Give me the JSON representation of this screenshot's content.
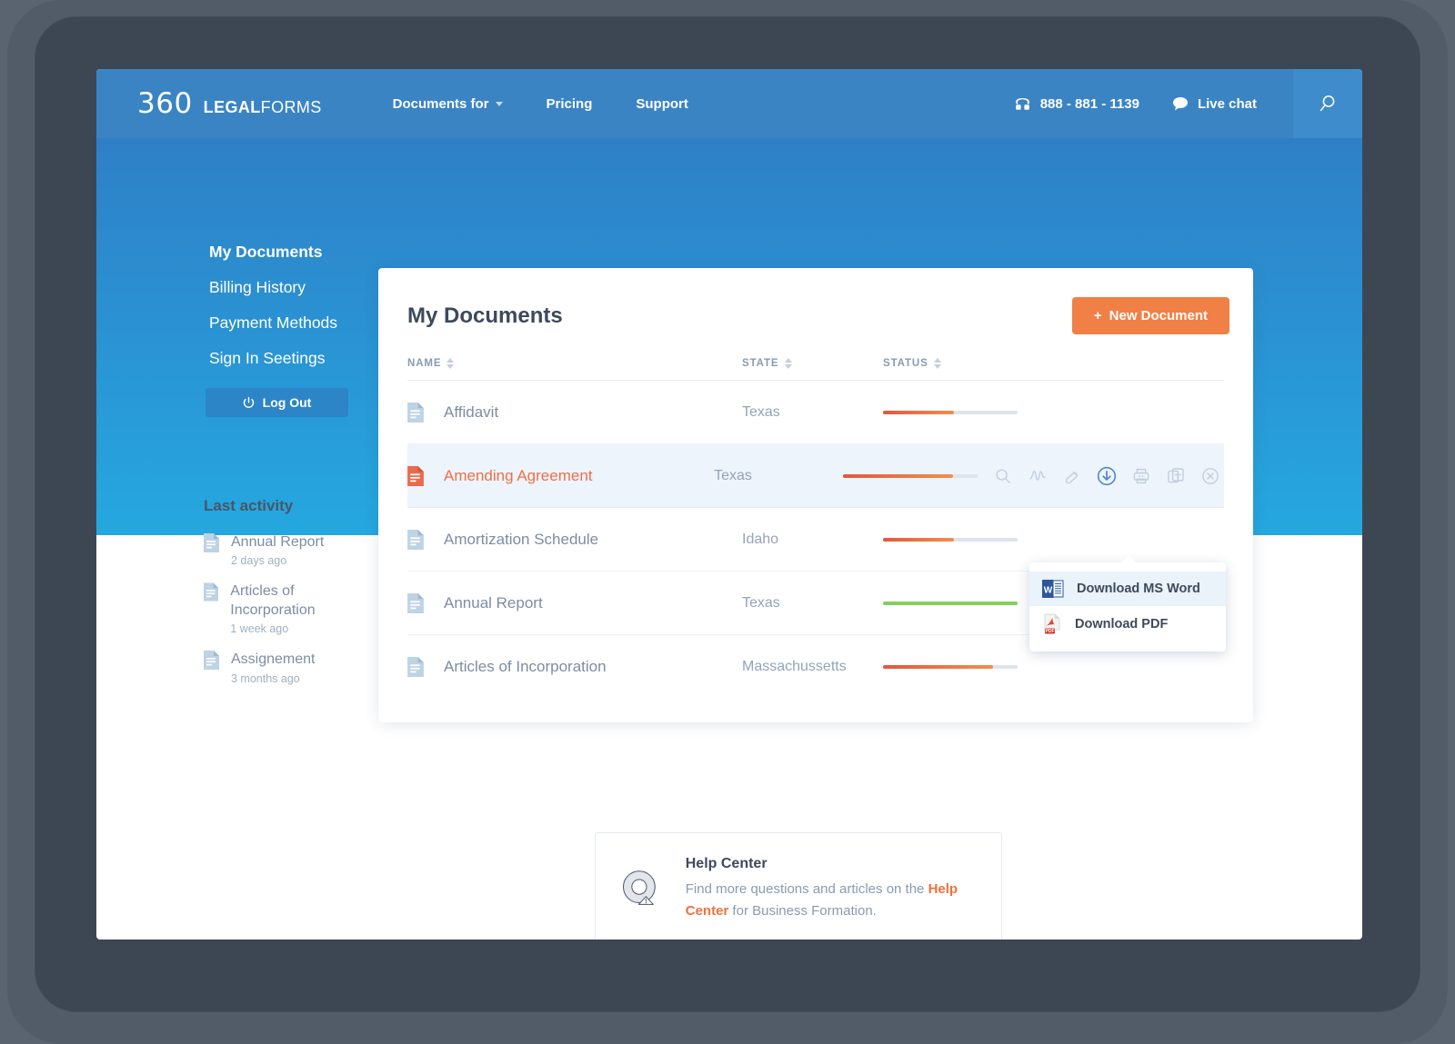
{
  "nav": {
    "logo": {
      "num": "360",
      "legal": "LEGAL",
      "forms": "FORMS"
    },
    "links": [
      {
        "label": "Documents for",
        "has_caret": true,
        "icon": "chevron-down-icon"
      },
      {
        "label": "Pricing",
        "has_caret": false
      },
      {
        "label": "Support",
        "has_caret": false
      }
    ],
    "phone": "888 - 881 - 1139",
    "phone_icon": "phone-icon",
    "chat": "Live chat",
    "chat_icon": "chat-bubble-icon",
    "search_icon": "search-icon"
  },
  "sidebar": {
    "items": [
      {
        "label": "My Documents",
        "active": true
      },
      {
        "label": "Billing History",
        "active": false
      },
      {
        "label": "Payment Methods",
        "active": false
      },
      {
        "label": "Sign In Seetings",
        "active": false
      }
    ],
    "logout": {
      "label": "Log Out",
      "icon": "power-icon"
    }
  },
  "activity": {
    "title": "Last activity",
    "items": [
      {
        "name": "Annual Report",
        "time": "2 days ago",
        "icon": "document-icon"
      },
      {
        "name": "Articles of Incorporation",
        "time": "1 week ago",
        "icon": "document-icon"
      },
      {
        "name": "Assignement",
        "time": "3 months ago",
        "icon": "document-icon"
      }
    ]
  },
  "documents": {
    "title": "My Documents",
    "new_button": {
      "plus": "+",
      "label": "New Document"
    },
    "columns": [
      {
        "key": "name",
        "label": "NAME"
      },
      {
        "key": "state",
        "label": "STATE"
      },
      {
        "key": "status",
        "label": "STATUS"
      }
    ],
    "rows": [
      {
        "name": "Affidavit",
        "state": "Texas",
        "progress": 53,
        "complete": false,
        "highlight": false
      },
      {
        "name": "Amending Agreement",
        "state": "Texas",
        "progress": 82,
        "complete": false,
        "highlight": true
      },
      {
        "name": "Amortization Schedule",
        "state": "Idaho",
        "progress": 53,
        "complete": false,
        "highlight": false
      },
      {
        "name": "Annual Report",
        "state": "Texas",
        "progress": 100,
        "complete": true,
        "highlight": false
      },
      {
        "name": "Articles of Incorporation",
        "state": "Massachussetts",
        "progress": 82,
        "complete": false,
        "highlight": false
      }
    ],
    "row_actions": [
      {
        "name": "preview-icon",
        "title": "Preview"
      },
      {
        "name": "sign-icon",
        "title": "Sign"
      },
      {
        "name": "edit-icon",
        "title": "Edit"
      },
      {
        "name": "download-icon",
        "title": "Download",
        "active": true
      },
      {
        "name": "print-icon",
        "title": "Print"
      },
      {
        "name": "duplicate-icon",
        "title": "Duplicate"
      },
      {
        "name": "delete-icon",
        "title": "Delete"
      }
    ]
  },
  "download_menu": {
    "items": [
      {
        "label": "Download MS Word",
        "icon": "ms-word-icon",
        "highlighted": true
      },
      {
        "label": "Download PDF",
        "icon": "pdf-icon",
        "highlighted": false
      }
    ]
  },
  "help": {
    "icon": "life-ring-warning-icon",
    "title": "Help Center",
    "text_before": "Find more questions and articles on the ",
    "link": "Help Center",
    "text_after": " for Business Formation."
  },
  "colors": {
    "brand_blue": "#3a84c4",
    "banner_top": "#2e80c6",
    "banner_bottom": "#25a8df",
    "accent_orange": "#f08046",
    "progress_start": "#e4573d",
    "progress_end": "#f08f4d",
    "progress_done": "#84d05a",
    "bezel": "#3d4754",
    "highlight_row": "#edf4fb"
  }
}
